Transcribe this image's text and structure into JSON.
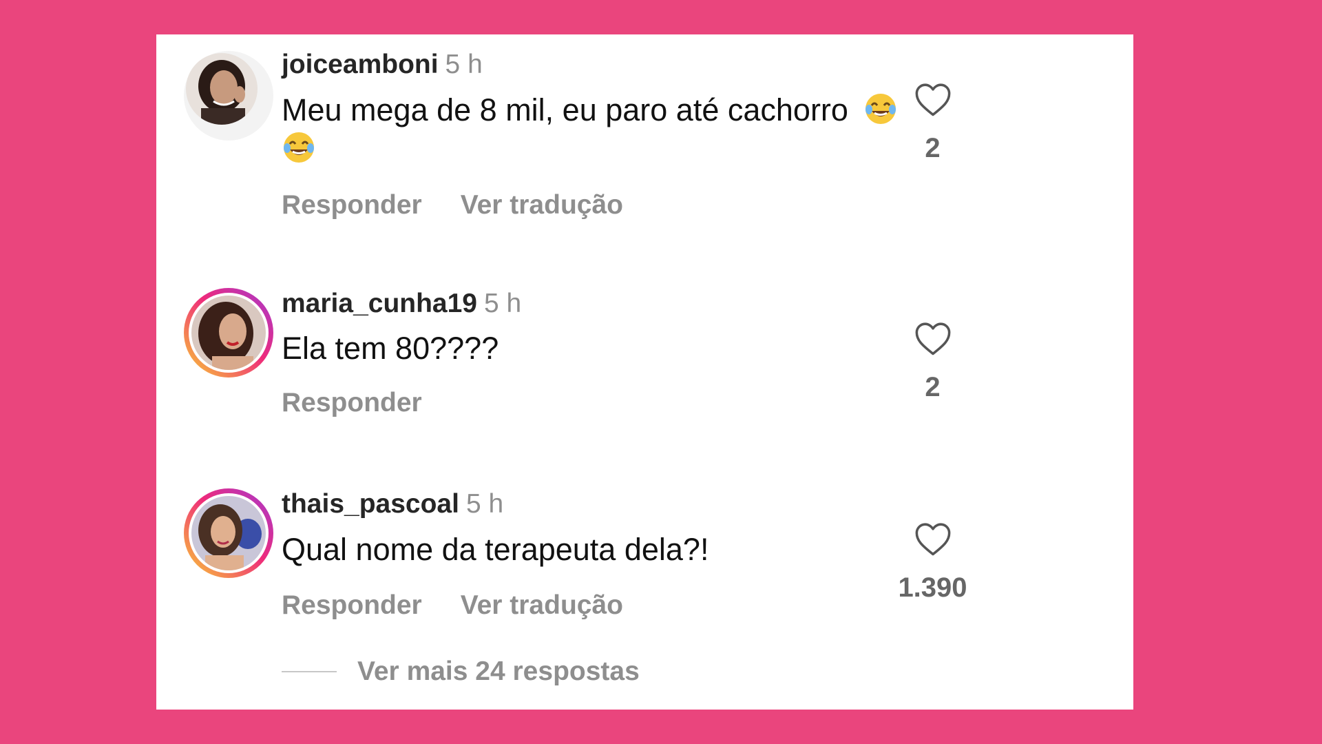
{
  "comments": [
    {
      "username": "joiceamboni",
      "time": "5 h",
      "text": "Meu mega de 8 mil, eu paro até cachorro",
      "emoji": [
        "face-with-tears-of-joy-emoji",
        "face-with-tears-of-joy-emoji"
      ],
      "actions": {
        "reply": "Responder",
        "translate": "Ver tradução"
      },
      "likes": "2",
      "avatar_ring": false
    },
    {
      "username": "maria_cunha19",
      "time": "5 h",
      "text": "Ela tem 80????",
      "actions": {
        "reply": "Responder"
      },
      "likes": "2",
      "avatar_ring": true
    },
    {
      "username": "thais_pascoal",
      "time": "5 h",
      "text": "Qual nome da terapeuta dela?!",
      "actions": {
        "reply": "Responder",
        "translate": "Ver tradução"
      },
      "likes": "1.390",
      "avatar_ring": true
    }
  ],
  "view_more": "Ver mais 24 respostas",
  "colors": {
    "background": "#ea457d",
    "card": "#ffffff",
    "username": "#262626",
    "secondary_text": "#8e8e8e",
    "comment_text": "#111111"
  },
  "icons": {
    "like": "heart-outline-icon",
    "emoji": "face-with-tears-of-joy-emoji"
  }
}
